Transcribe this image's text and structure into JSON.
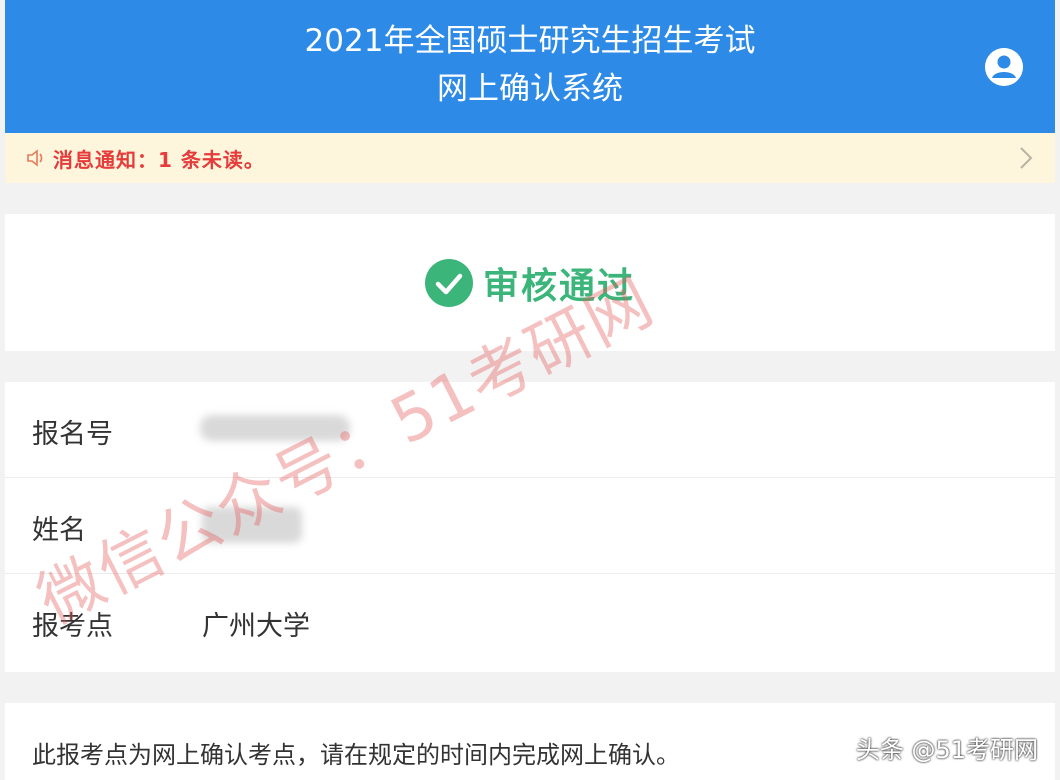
{
  "header": {
    "title_line1": "2021年全国硕士研究生招生考试",
    "title_line2": "网上确认系统",
    "user_icon": "user-avatar-icon"
  },
  "notice": {
    "speaker_icon": "speaker-icon",
    "text": "消息通知：1 条未读。",
    "chevron_icon": "chevron-right-icon"
  },
  "status": {
    "icon": "check-circle-icon",
    "label": "审核通过",
    "color": "#3bb57a"
  },
  "info": {
    "rows": [
      {
        "key": "报名号",
        "value": ""
      },
      {
        "key": "姓名",
        "value": ""
      },
      {
        "key": "报考点",
        "value": "广州大学"
      }
    ]
  },
  "note": {
    "text": "此报考点为网上确认考点，请在规定的时间内完成网上确认。"
  },
  "watermark": {
    "text": "微信公众号：51考研网"
  },
  "credit": {
    "text": "头条 @51考研网"
  },
  "colors": {
    "header_bg": "#2d8ae6",
    "notice_bg": "#fdf6dc",
    "notice_text": "#e53b3b"
  }
}
